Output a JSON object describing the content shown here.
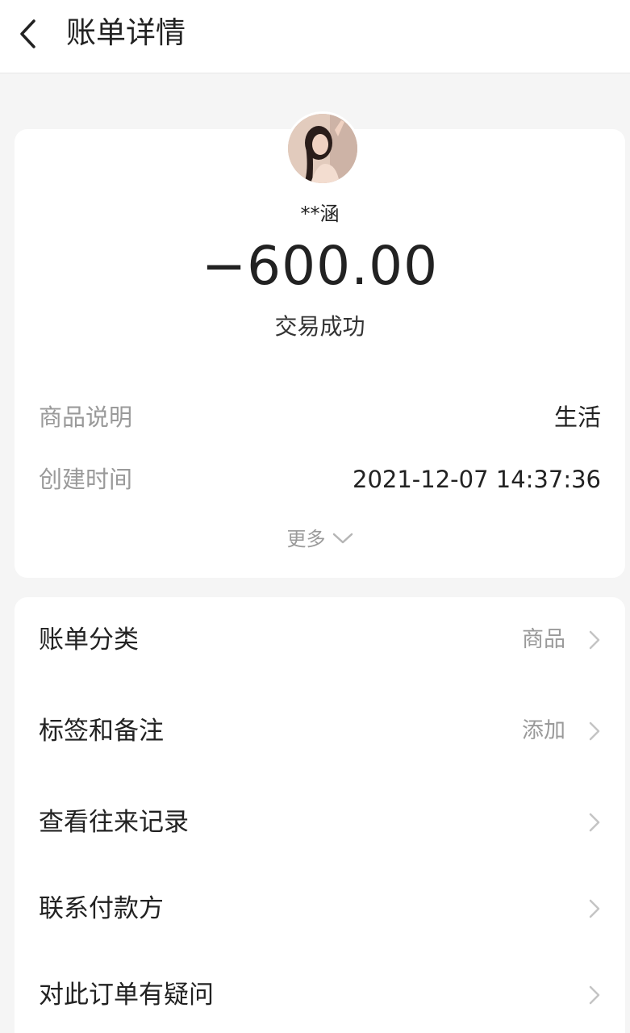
{
  "header": {
    "title": "账单详情"
  },
  "transaction": {
    "counterparty": "**涵",
    "amount": "−600.00",
    "status": "交易成功"
  },
  "details": [
    {
      "label": "商品说明",
      "value": "生活"
    },
    {
      "label": "创建时间",
      "value": "2021-12-07 14:37:36"
    }
  ],
  "more_label": "更多",
  "menu": [
    {
      "label": "账单分类",
      "value": "商品"
    },
    {
      "label": "标签和备注",
      "value": "添加"
    },
    {
      "label": "查看往来记录",
      "value": ""
    },
    {
      "label": "联系付款方",
      "value": ""
    },
    {
      "label": "对此订单有疑问",
      "value": ""
    }
  ]
}
